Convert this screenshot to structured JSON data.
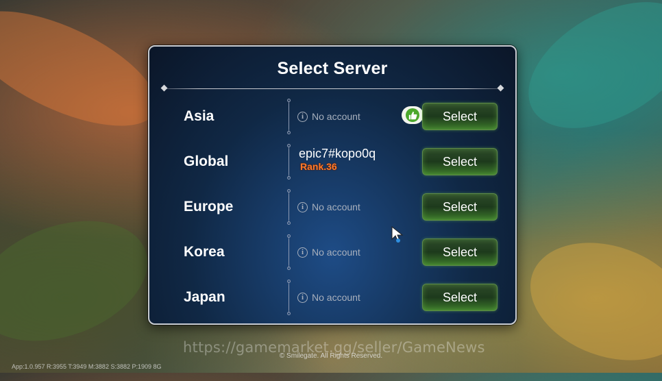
{
  "title": "Select Server",
  "select_label": "Select",
  "servers": [
    {
      "region": "Asia",
      "account": "No account",
      "recommended": true
    },
    {
      "region": "Global",
      "account": "epic7#kopo0q",
      "rank": "Rank.36"
    },
    {
      "region": "Europe",
      "account": "No account"
    },
    {
      "region": "Korea",
      "account": "No account"
    },
    {
      "region": "Japan",
      "account": "No account"
    }
  ],
  "watermark": "https://gamemarket.gg/seller/GameNews",
  "copyright": "© Smilegate. All Rights Reserved.",
  "version": "App:1.0.957 R:3955 T:3949 M:3882 S:3882 P:1909 8G",
  "colors": {
    "panel": "#102845",
    "button": "#2e4b2a",
    "rank": "#ff7a2a",
    "recommend_badge": "#4ba82c"
  },
  "icons": {
    "info": "info-icon",
    "recommend": "thumbs-up-icon",
    "cursor": "mouse-cursor-icon"
  }
}
